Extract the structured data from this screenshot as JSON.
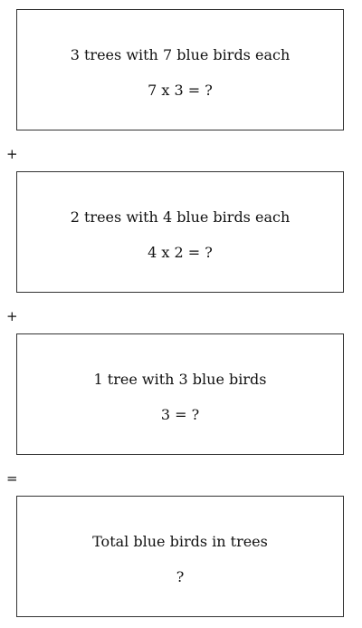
{
  "boxes": [
    {
      "line1": "3 trees with 7 blue birds each",
      "line2": "7 x 3 = ?"
    },
    {
      "line1": "2 trees with 4 blue birds each",
      "line2": "4 x 2 = ?"
    },
    {
      "line1": "1 tree with 3 blue birds",
      "line2": "3 = ?"
    },
    {
      "line1": "Total blue birds in trees",
      "line2": "?"
    }
  ],
  "operators": [
    "+",
    "+",
    "="
  ]
}
